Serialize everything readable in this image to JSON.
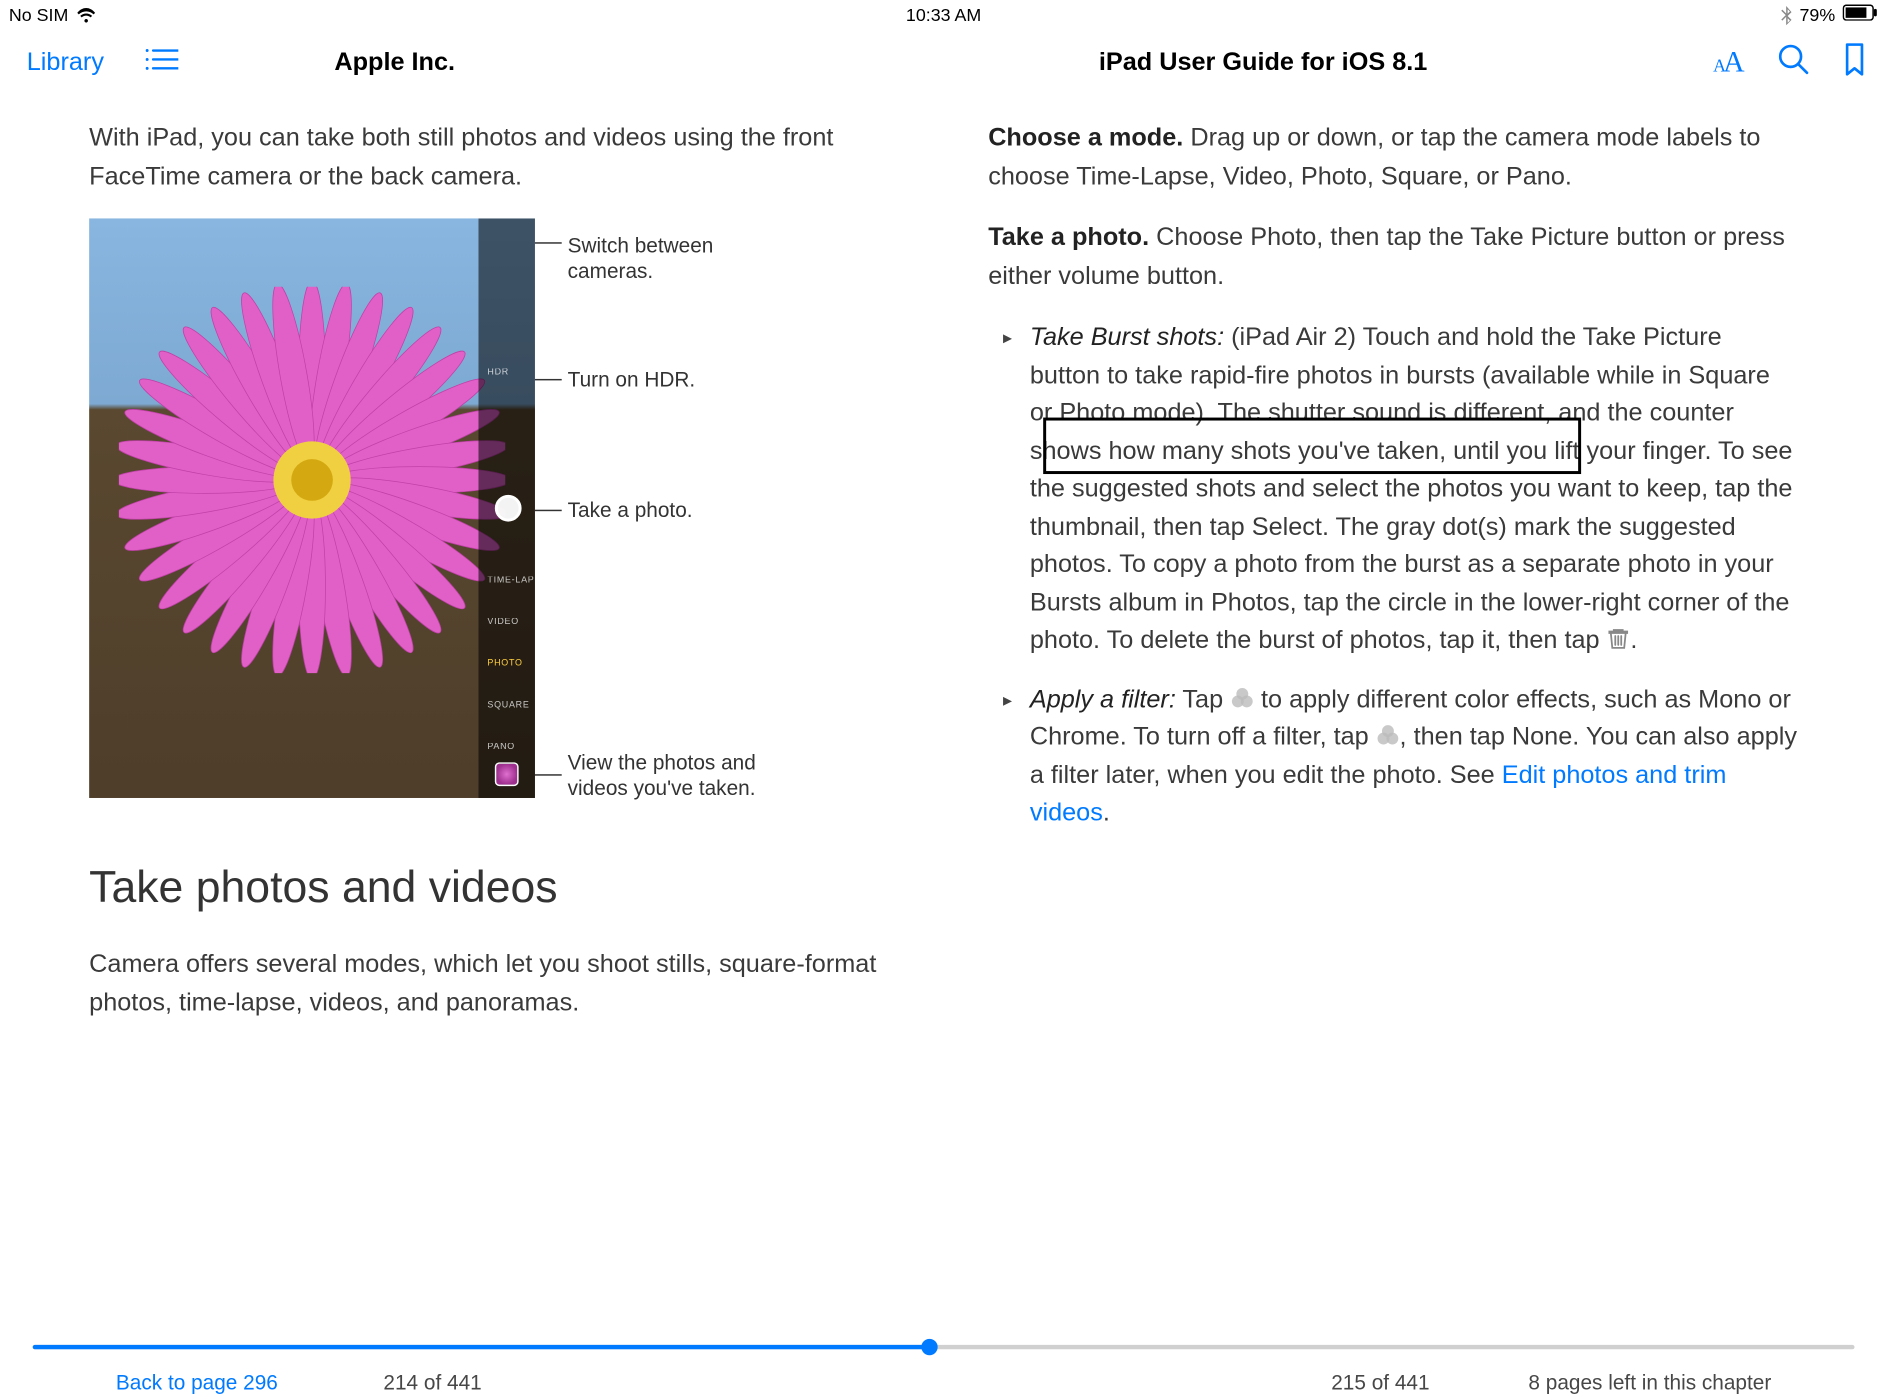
{
  "status": {
    "carrier": "No SIM",
    "time": "10:33 AM",
    "battery": "79%",
    "bluetooth_icon": "bluetooth",
    "wifi_icon": "wifi"
  },
  "toolbar": {
    "library_label": "Library",
    "author": "Apple Inc.",
    "book_title": "iPad User Guide for iOS 8.1"
  },
  "left_col": {
    "intro": "With iPad, you can take both still photos and videos using the front FaceTime camera or the back camera.",
    "callouts": {
      "switch": "Switch between cameras.",
      "hdr": "Turn on HDR.",
      "take": "Take a photo.",
      "view1": "View the photos and",
      "view2": "videos you've taken."
    },
    "cam_modes": {
      "timelapse": "TIME-LAPSE",
      "video": "VIDEO",
      "photo": "PHOTO",
      "square": "SQUARE",
      "pano": "PANO",
      "hdr": "HDR"
    },
    "heading": "Take photos and videos",
    "modes_desc": "Camera offers several modes, which let you shoot stills, square-format photos, time-lapse, videos, and panoramas."
  },
  "right_col": {
    "choose_mode_bold": "Choose a mode.",
    "choose_mode_rest": " Drag up or down, or tap the camera mode labels to choose Time-Lapse, Video, Photo, Square, or Pano.",
    "take_photo_bold": "Take a photo.",
    "take_photo_rest": " Choose Photo, then tap the Take Picture button or press either volume button.",
    "burst_label_italic": "Take Burst shots:",
    "burst_prefix": "  (iPad Air 2) Touch and hold the Take Picture button to take rapid-fire photos in bursts (available while in Square or Photo mode). The shutter sound is different, and the counter shows how many shots you've taken, until you lift your finger. To see the suggested shots and select the photos you want to keep, tap the thumbnail, then tap Select. The gray dot(s) mark the suggested photos. To copy a photo from the burst as a separate photo in your Bursts album in Photos, tap the circle in the lower-right corner of the photo. To delete the burst of photos, tap it, then tap ",
    "burst_suffix": ".",
    "filter_label_italic": "Apply a filter:",
    "filter_before": "  Tap ",
    "filter_mid": " to apply different color effects, such as Mono or Chrome. To turn off a filter, tap ",
    "filter_after": ", then tap None. You can also apply a filter later, when you edit the photo. See ",
    "filter_link": "Edit photos and trim videos",
    "filter_end": "."
  },
  "footer": {
    "back_link": "Back to page 296",
    "left_page": "214 of 441",
    "right_page": "215 of 441",
    "pages_left": "8 pages left in this chapter"
  }
}
